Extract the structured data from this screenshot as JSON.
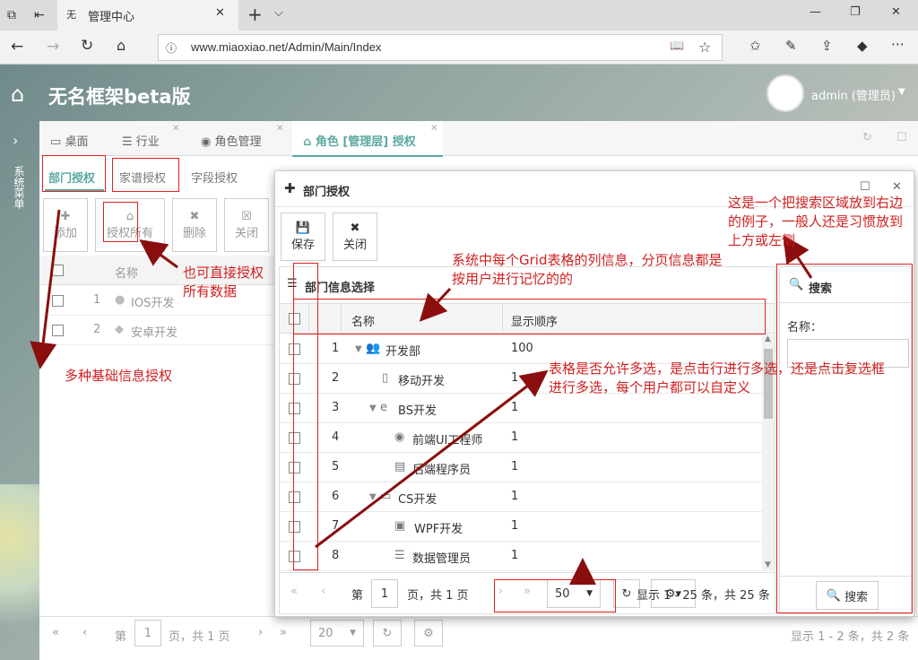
{
  "browser": {
    "tab_title": "管理中心",
    "url": "www.miaoxiao.net/Admin/Main/Index"
  },
  "app": {
    "title": "无名框架beta版",
    "user": "admin (管理员)",
    "sidebar_label": "系统菜单"
  },
  "tabs": [
    {
      "label": "桌面"
    },
    {
      "label": "行业"
    },
    {
      "label": "角色管理"
    },
    {
      "label": "角色 [管理层] 授权"
    }
  ],
  "subtabs": [
    "部门授权",
    "家谱授权",
    "字段授权"
  ],
  "bgtoolbar": {
    "add": "添加",
    "grant_all": "授权所有",
    "delete": "删除",
    "close": "关闭"
  },
  "bggrid": {
    "col_name": "名称",
    "rows": [
      {
        "num": "1",
        "name": "IOS开发"
      },
      {
        "num": "2",
        "name": "安卓开发"
      }
    ]
  },
  "bgpager": {
    "page_prefix": "第",
    "page": "1",
    "page_suffix": "页，共 1 页",
    "size": "20",
    "info": "显示 1 - 2 条，共 2 条"
  },
  "dialog": {
    "title": "部门授权",
    "save": "保存",
    "close": "关闭",
    "grid_title": "部门信息选择",
    "col_name": "名称",
    "col_order": "显示顺序",
    "rows": [
      {
        "num": "1",
        "name": "开发部",
        "order": "100"
      },
      {
        "num": "2",
        "name": "移动开发",
        "order": "1"
      },
      {
        "num": "3",
        "name": "BS开发",
        "order": "1"
      },
      {
        "num": "4",
        "name": "前端UI工程师",
        "order": "1"
      },
      {
        "num": "5",
        "name": "后端程序员",
        "order": "1"
      },
      {
        "num": "6",
        "name": "CS开发",
        "order": "1"
      },
      {
        "num": "7",
        "name": "WPF开发",
        "order": "1"
      },
      {
        "num": "8",
        "name": "数据管理员",
        "order": "1"
      }
    ],
    "pager": {
      "page_prefix": "第",
      "page": "1",
      "page_suffix": "页，共 1 页",
      "size": "50",
      "info": "显示 1 - 25 条，共 25 条"
    },
    "search": {
      "title": "搜索",
      "label": "名称：",
      "button": "搜索"
    }
  },
  "notes": {
    "n1": "也可直接授权\n所有数据",
    "n2": "多种基础信息授权",
    "n3": "系统中每个Grid表格的列信息，分页信息都是\n按用户进行记忆的的",
    "n4": "这是一个把搜索区域放到右边\n的例子，一般人还是习惯放到\n上方或左侧",
    "n5": "表格是否允许多选，是点击行进行多选，还是点击复选框\n进行多选，每个用户都可以自定义"
  },
  "colors": {
    "accent": "#5aa9a0",
    "annotation": "#d02020"
  }
}
